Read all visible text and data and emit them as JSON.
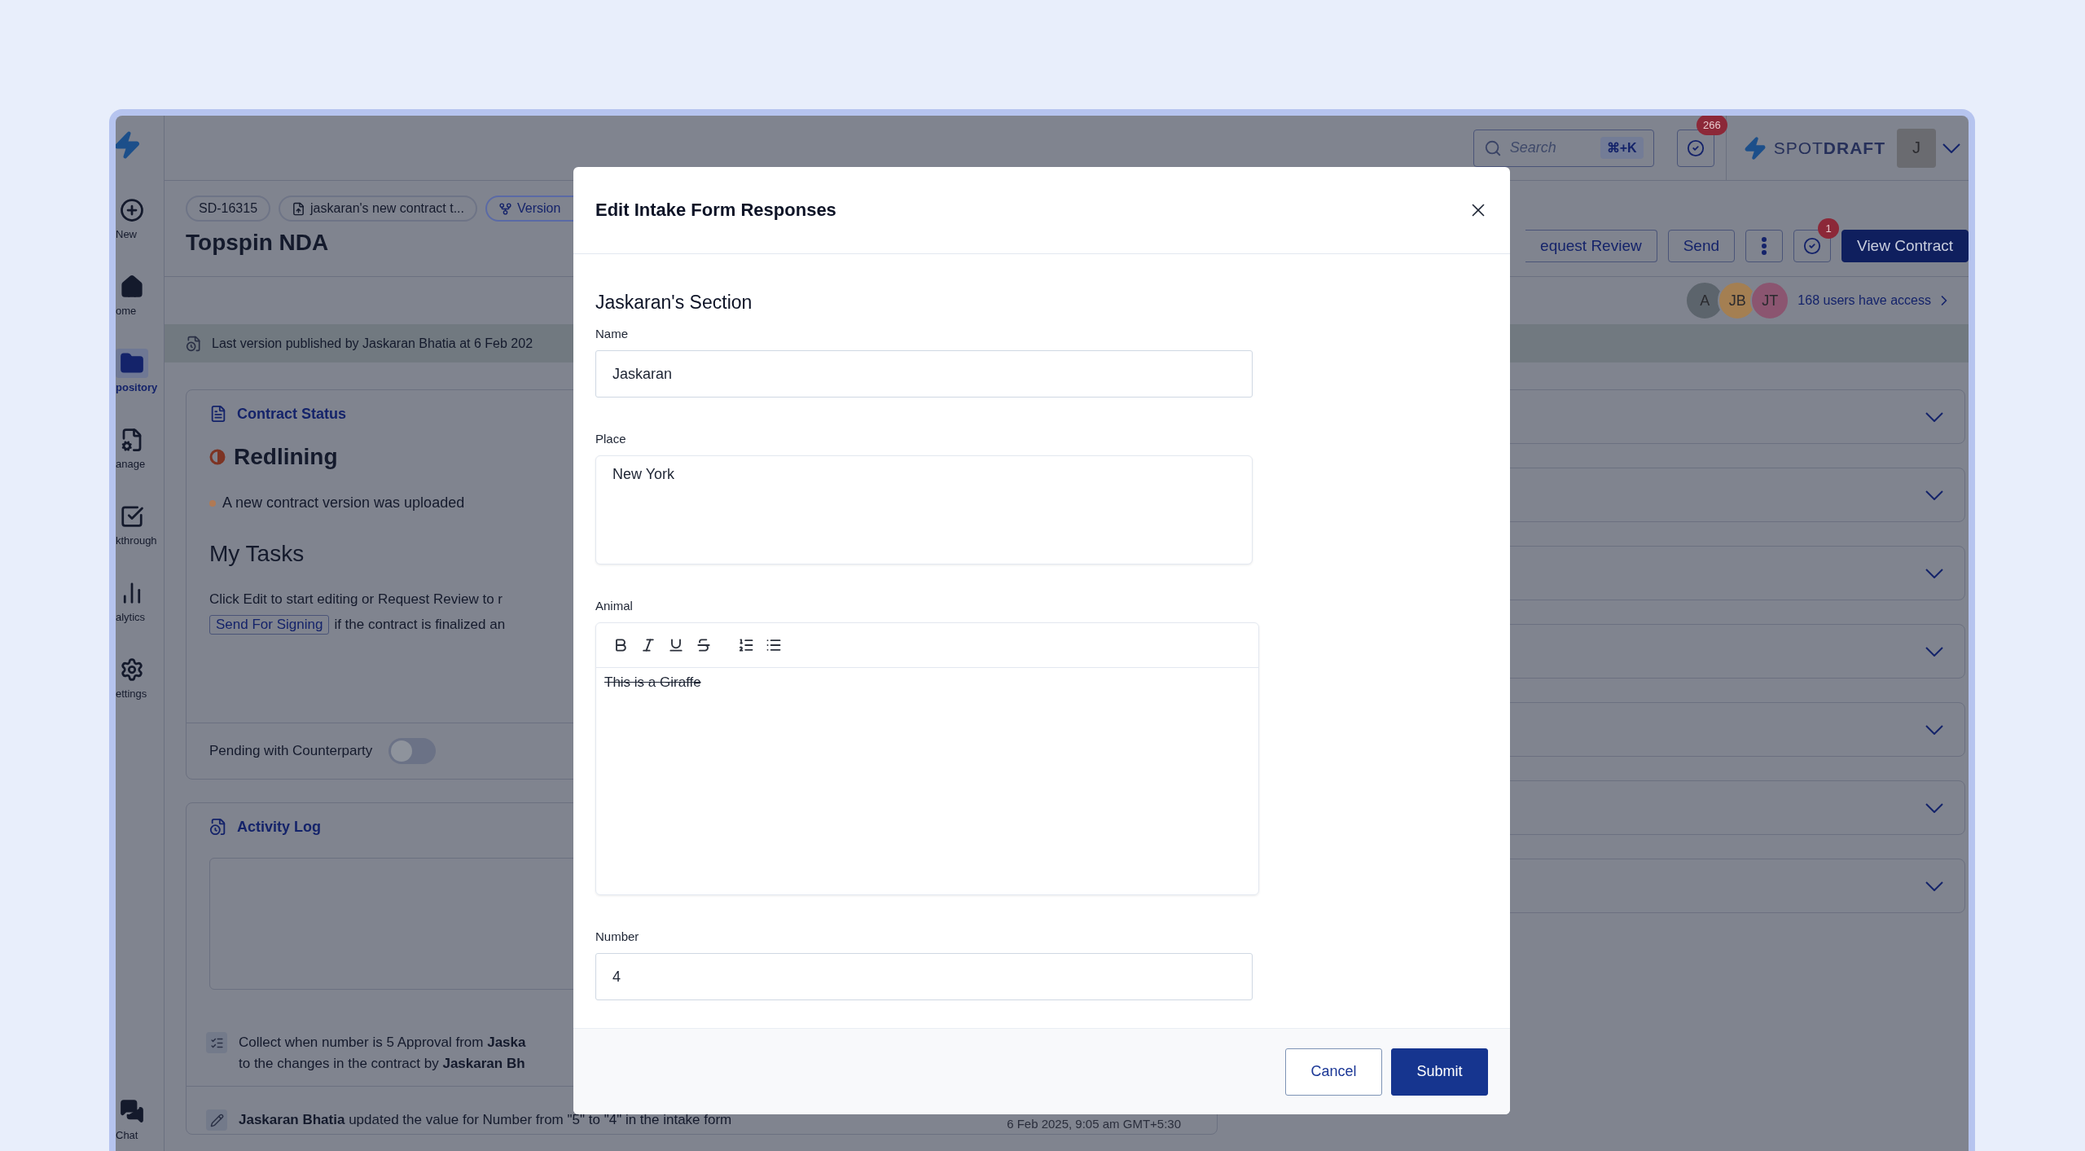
{
  "sidebar": {
    "items": [
      {
        "kind": "new",
        "label": "New",
        "selected": false
      },
      {
        "kind": "home",
        "label": "ome",
        "selected": false
      },
      {
        "kind": "repository",
        "label": "pository",
        "selected": true
      },
      {
        "kind": "manage",
        "label": "anage",
        "selected": false
      },
      {
        "kind": "walkthrough",
        "label": "kthrough",
        "selected": false
      },
      {
        "kind": "analytics",
        "label": "alytics",
        "selected": false
      },
      {
        "kind": "settings",
        "label": "ettings",
        "selected": false
      }
    ],
    "bottom": {
      "kind": "chat",
      "label": "Chat",
      "selected": false
    }
  },
  "header": {
    "search": {
      "placeholder": "Search",
      "shortcut": "⌘+K"
    },
    "tasks_badge": "266",
    "brand": "SPOT**DRAFT**",
    "user_initial": "J"
  },
  "contract": {
    "chips": [
      {
        "kind": "id",
        "label": "SD-16315"
      },
      {
        "kind": "document",
        "label": "jaskaran's new contract t..."
      },
      {
        "kind": "version",
        "label": "Version"
      }
    ],
    "title": "Topspin NDA",
    "actions": [
      {
        "kind": "text",
        "label": "equest Review"
      },
      {
        "kind": "text",
        "label": "Send"
      },
      {
        "kind": "more"
      },
      {
        "kind": "tasks",
        "badge": "1"
      },
      {
        "kind": "primary",
        "label": "View Contract"
      }
    ],
    "access": {
      "avatars": [
        {
          "initials": "A",
          "color": "#5c646c"
        },
        {
          "initials": "JB",
          "color": "#a47f52"
        },
        {
          "initials": "JT",
          "color": "#8b5570"
        }
      ],
      "label": "168 users have access"
    },
    "banner": "Last version published by Jaskaran Bhatia at 6 Feb 202"
  },
  "status_card": {
    "title": "Contract Status",
    "status": "Redlining",
    "note": "A new contract version was uploaded",
    "tasks_title": "My Tasks",
    "tasks_text": "Click Edit to start editing or Request Review to r",
    "signing_button": "Send For Signing",
    "tasks_text_after": "if the contract is finalized an",
    "pending": {
      "label": "Pending with Counterparty",
      "on": false
    }
  },
  "activity": {
    "title": "Activity Log",
    "entries": [
      {
        "kind": "approval",
        "lines": [
          "Collect when number is 5 Approval from **Jaska**",
          "to the changes in the contract by **Jaskaran Bh**"
        ]
      },
      {
        "kind": "edit",
        "lines": [
          "**Jaskaran Bhatia** updated the value for Number from \"5\" to \"4\" in the intake form"
        ],
        "time": "6 Feb 2025, 9:05 am GMT+5:30"
      }
    ]
  },
  "accordions": [
    {
      "expanded": false
    },
    {
      "expanded": false
    },
    {
      "expanded": false
    },
    {
      "expanded": false
    },
    {
      "expanded": false
    },
    {
      "expanded": false
    },
    {
      "expanded": false
    }
  ],
  "modal": {
    "title": "Edit Intake Form Responses",
    "section": "Jaskaran's Section",
    "fields": [
      {
        "kind": "text",
        "label": "Name",
        "value": "Jaskaran"
      },
      {
        "kind": "textarea",
        "label": "Place",
        "value": "New York"
      },
      {
        "kind": "rich",
        "label": "Animal",
        "toolbar": [
          {
            "kind": "bold"
          },
          {
            "kind": "italic"
          },
          {
            "kind": "underline"
          },
          {
            "kind": "strike"
          },
          {
            "kind": "ordered"
          },
          {
            "kind": "bullet"
          }
        ],
        "value": "This is a Giraffe",
        "strikethrough": true
      },
      {
        "kind": "text",
        "label": "Number",
        "value": "4"
      }
    ],
    "buttons": [
      {
        "kind": "secondary",
        "label": "Cancel"
      },
      {
        "kind": "primary",
        "label": "Submit"
      }
    ]
  }
}
